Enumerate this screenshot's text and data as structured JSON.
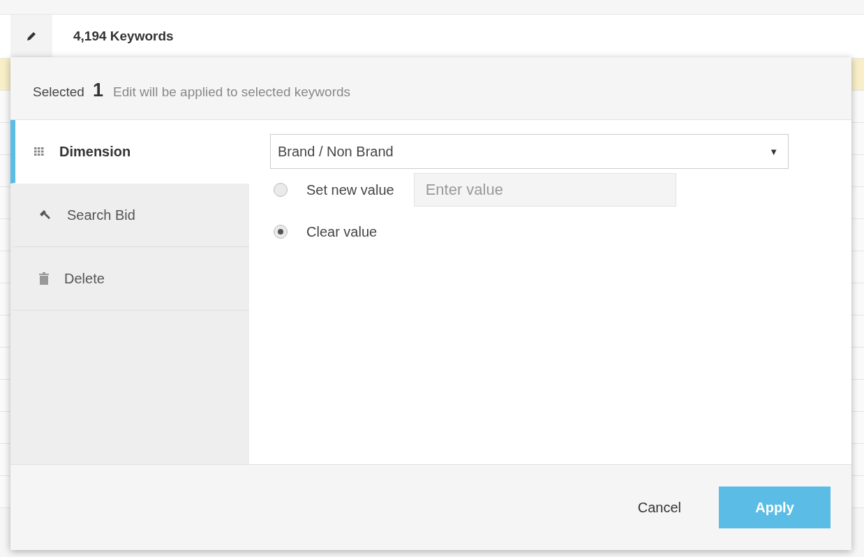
{
  "header": {
    "title": "4,194 Keywords"
  },
  "summary": {
    "label": "Selected",
    "count": "1",
    "note": "Edit will be applied to selected keywords"
  },
  "menu": [
    {
      "label": "Dimension",
      "kind": "grid",
      "selected": true
    },
    {
      "label": "Search Bid",
      "kind": "gavel",
      "selected": false
    },
    {
      "label": "Delete",
      "kind": "trash",
      "selected": false
    }
  ],
  "dimension_select": {
    "value": "Brand / Non Brand",
    "arrow": "▼"
  },
  "options": [
    {
      "label": "Set new value",
      "selected": false,
      "kind": "input",
      "input": {
        "placeholder": "Enter value",
        "disabled": true
      }
    },
    {
      "label": "Clear value",
      "selected": true,
      "kind": "plain"
    }
  ],
  "buttons": [
    {
      "label": "Cancel",
      "kind": "text"
    },
    {
      "label": "Apply",
      "kind": "primary"
    }
  ]
}
